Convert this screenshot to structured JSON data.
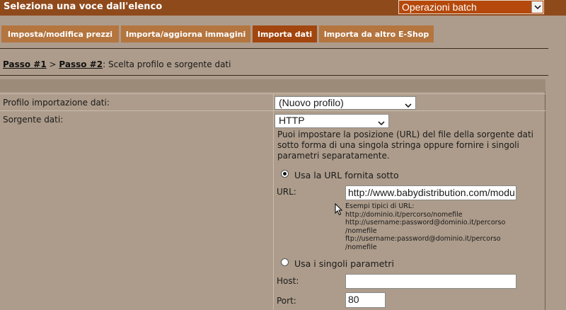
{
  "header": {
    "title": "Seleziona una voce dall'elenco",
    "batch_select": "Operazioni batch"
  },
  "tabs": [
    {
      "label": "Imposta/modifica prezzi",
      "active": false
    },
    {
      "label": "Importa/aggiorna immagini",
      "active": false
    },
    {
      "label": "Importa dati",
      "active": true
    },
    {
      "label": "Importa da altro E-Shop",
      "active": false
    }
  ],
  "breadcrumb": {
    "step1": "Passo #1",
    "separator": ">",
    "step2": "Passo #2",
    "current": ": Scelta profilo e sorgente dati"
  },
  "form": {
    "profile_label": "Profilo importazione dati:",
    "profile_value": "(Nuovo profilo)",
    "source_label": "Sorgente dati:",
    "source_value": "HTTP",
    "description": "Puoi impostare la posizione (URL) del file della sorgente dati sotto forma di una singola stringa oppure fornire i singoli parametri separatamente.",
    "radio_url_label": "Usa la URL fornita sotto",
    "url_label": "URL:",
    "url_value": "http://www.babydistribution.com/modu",
    "examples_title": "Esempi tipici di URL:",
    "examples": [
      "http://dominio.it/percorso/nomefile",
      "http://username:password@dominio.it/percorso",
      "/nomefile",
      "ftp://username:password@dominio.it/percorso",
      "/nomefile"
    ],
    "radio_params_label": "Usa i singoli parametri",
    "host_label": "Host:",
    "host_value": "",
    "port_label": "Port:",
    "port_value": "80"
  },
  "colors": {
    "header_bg": "#8f4a1c",
    "tab_bg": "#b4753f",
    "tab_active_bg": "#a2450e",
    "page_bg": "#ad9c8b"
  }
}
